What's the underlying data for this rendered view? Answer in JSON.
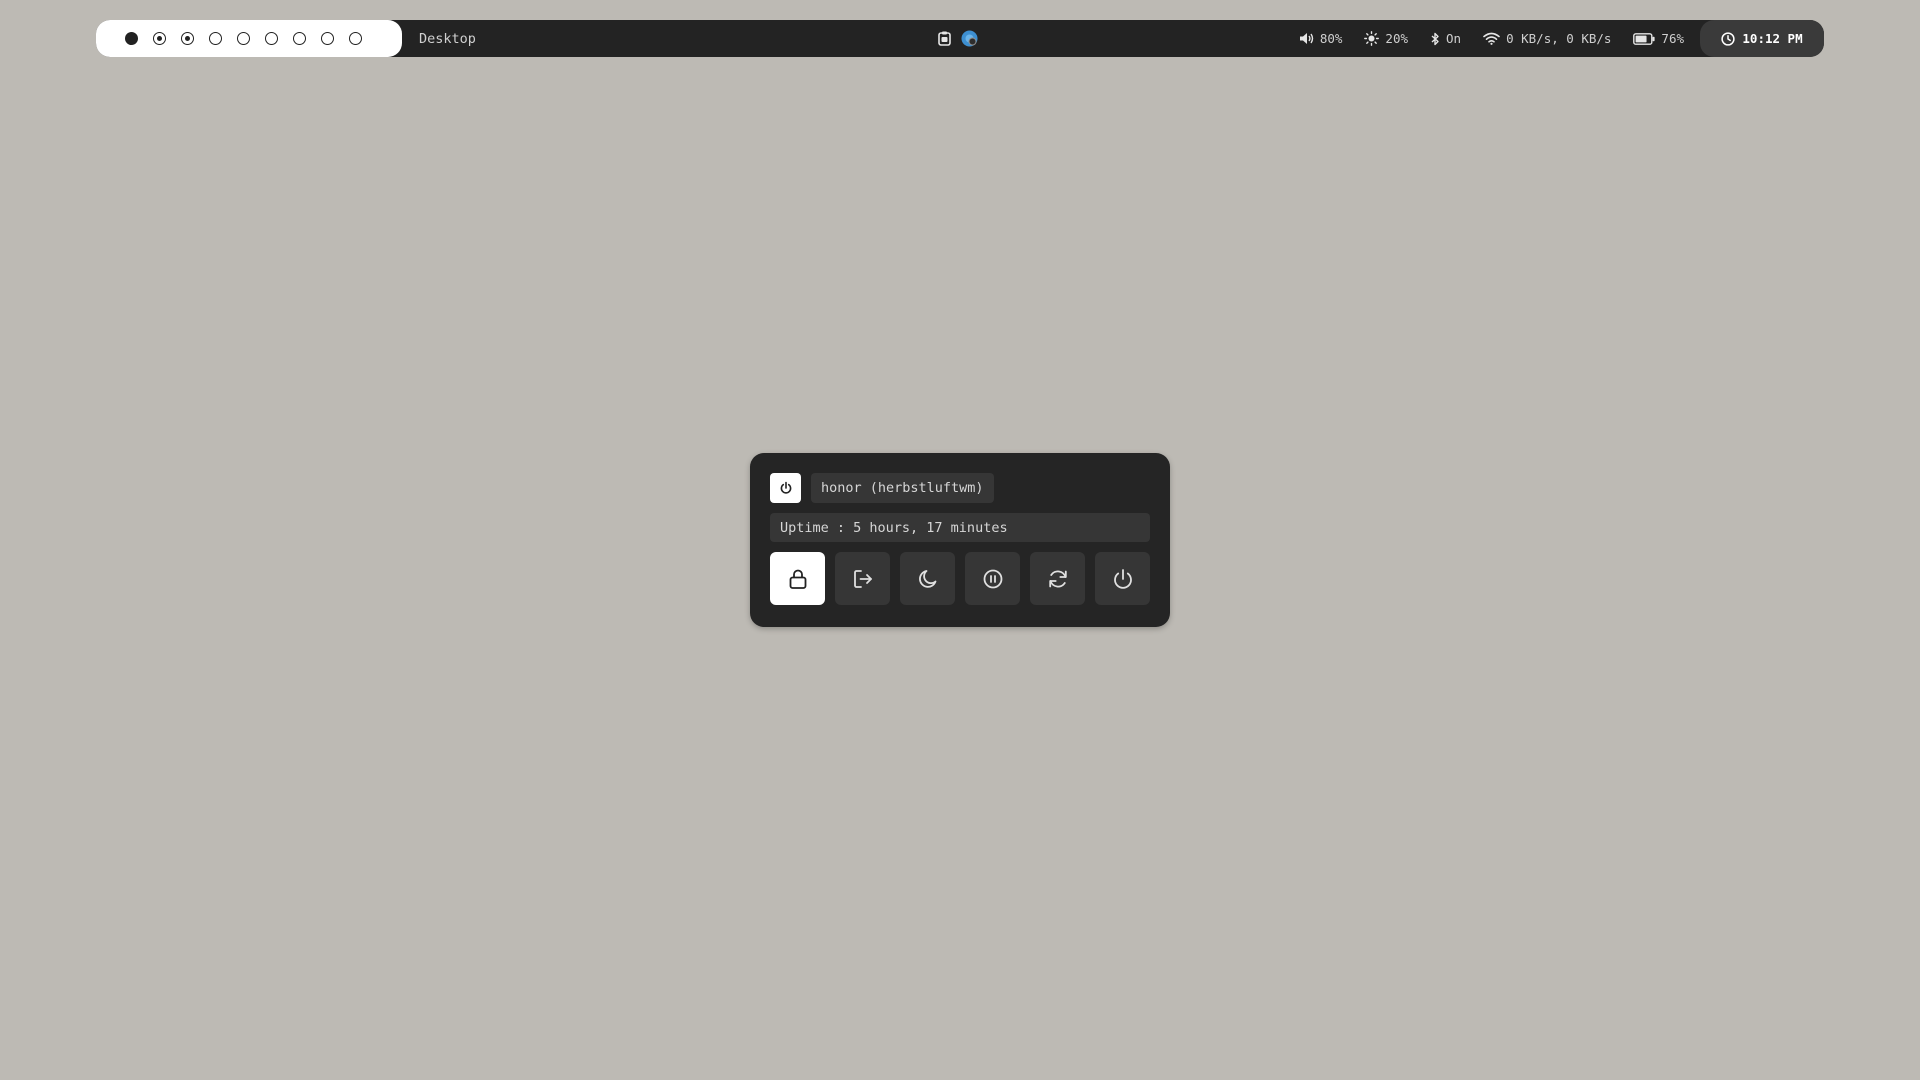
{
  "topbar": {
    "workspaces": [
      {
        "state": "active"
      },
      {
        "state": "occupied"
      },
      {
        "state": "occupied"
      },
      {
        "state": "empty"
      },
      {
        "state": "empty"
      },
      {
        "state": "empty"
      },
      {
        "state": "empty"
      },
      {
        "state": "empty"
      },
      {
        "state": "empty"
      }
    ],
    "window_title": "Desktop",
    "tray_icons": [
      "clipboard-icon",
      "app-indicator-icon"
    ],
    "volume": {
      "icon": "speaker-icon",
      "text": "80%"
    },
    "brightness": {
      "icon": "sun-icon",
      "text": "20%"
    },
    "bluetooth": {
      "icon": "bluetooth-icon",
      "text": "On"
    },
    "network": {
      "icon": "wifi-icon",
      "text": "0 KB/s, 0 KB/s"
    },
    "battery": {
      "icon": "battery-icon",
      "text": "76%",
      "level": 0.76
    },
    "clock": {
      "icon": "clock-icon",
      "text": "10:12 PM"
    }
  },
  "powermenu": {
    "header_icon": "power-icon",
    "host": "honor (herbstluftwm)",
    "uptime": "Uptime : 5 hours, 17 minutes",
    "buttons": [
      {
        "name": "lock",
        "icon": "lock-icon"
      },
      {
        "name": "logout",
        "icon": "logout-icon"
      },
      {
        "name": "sleep",
        "icon": "moon-icon"
      },
      {
        "name": "suspend",
        "icon": "pause-icon"
      },
      {
        "name": "reboot",
        "icon": "reboot-icon"
      },
      {
        "name": "shutdown",
        "icon": "power-icon"
      }
    ],
    "selected": "lock"
  },
  "colors": {
    "desktop_bg": "#bdbab4",
    "bar_bg": "#232323",
    "panel_bg": "#252525",
    "field_bg": "#363636",
    "accent": "#ffffff"
  }
}
